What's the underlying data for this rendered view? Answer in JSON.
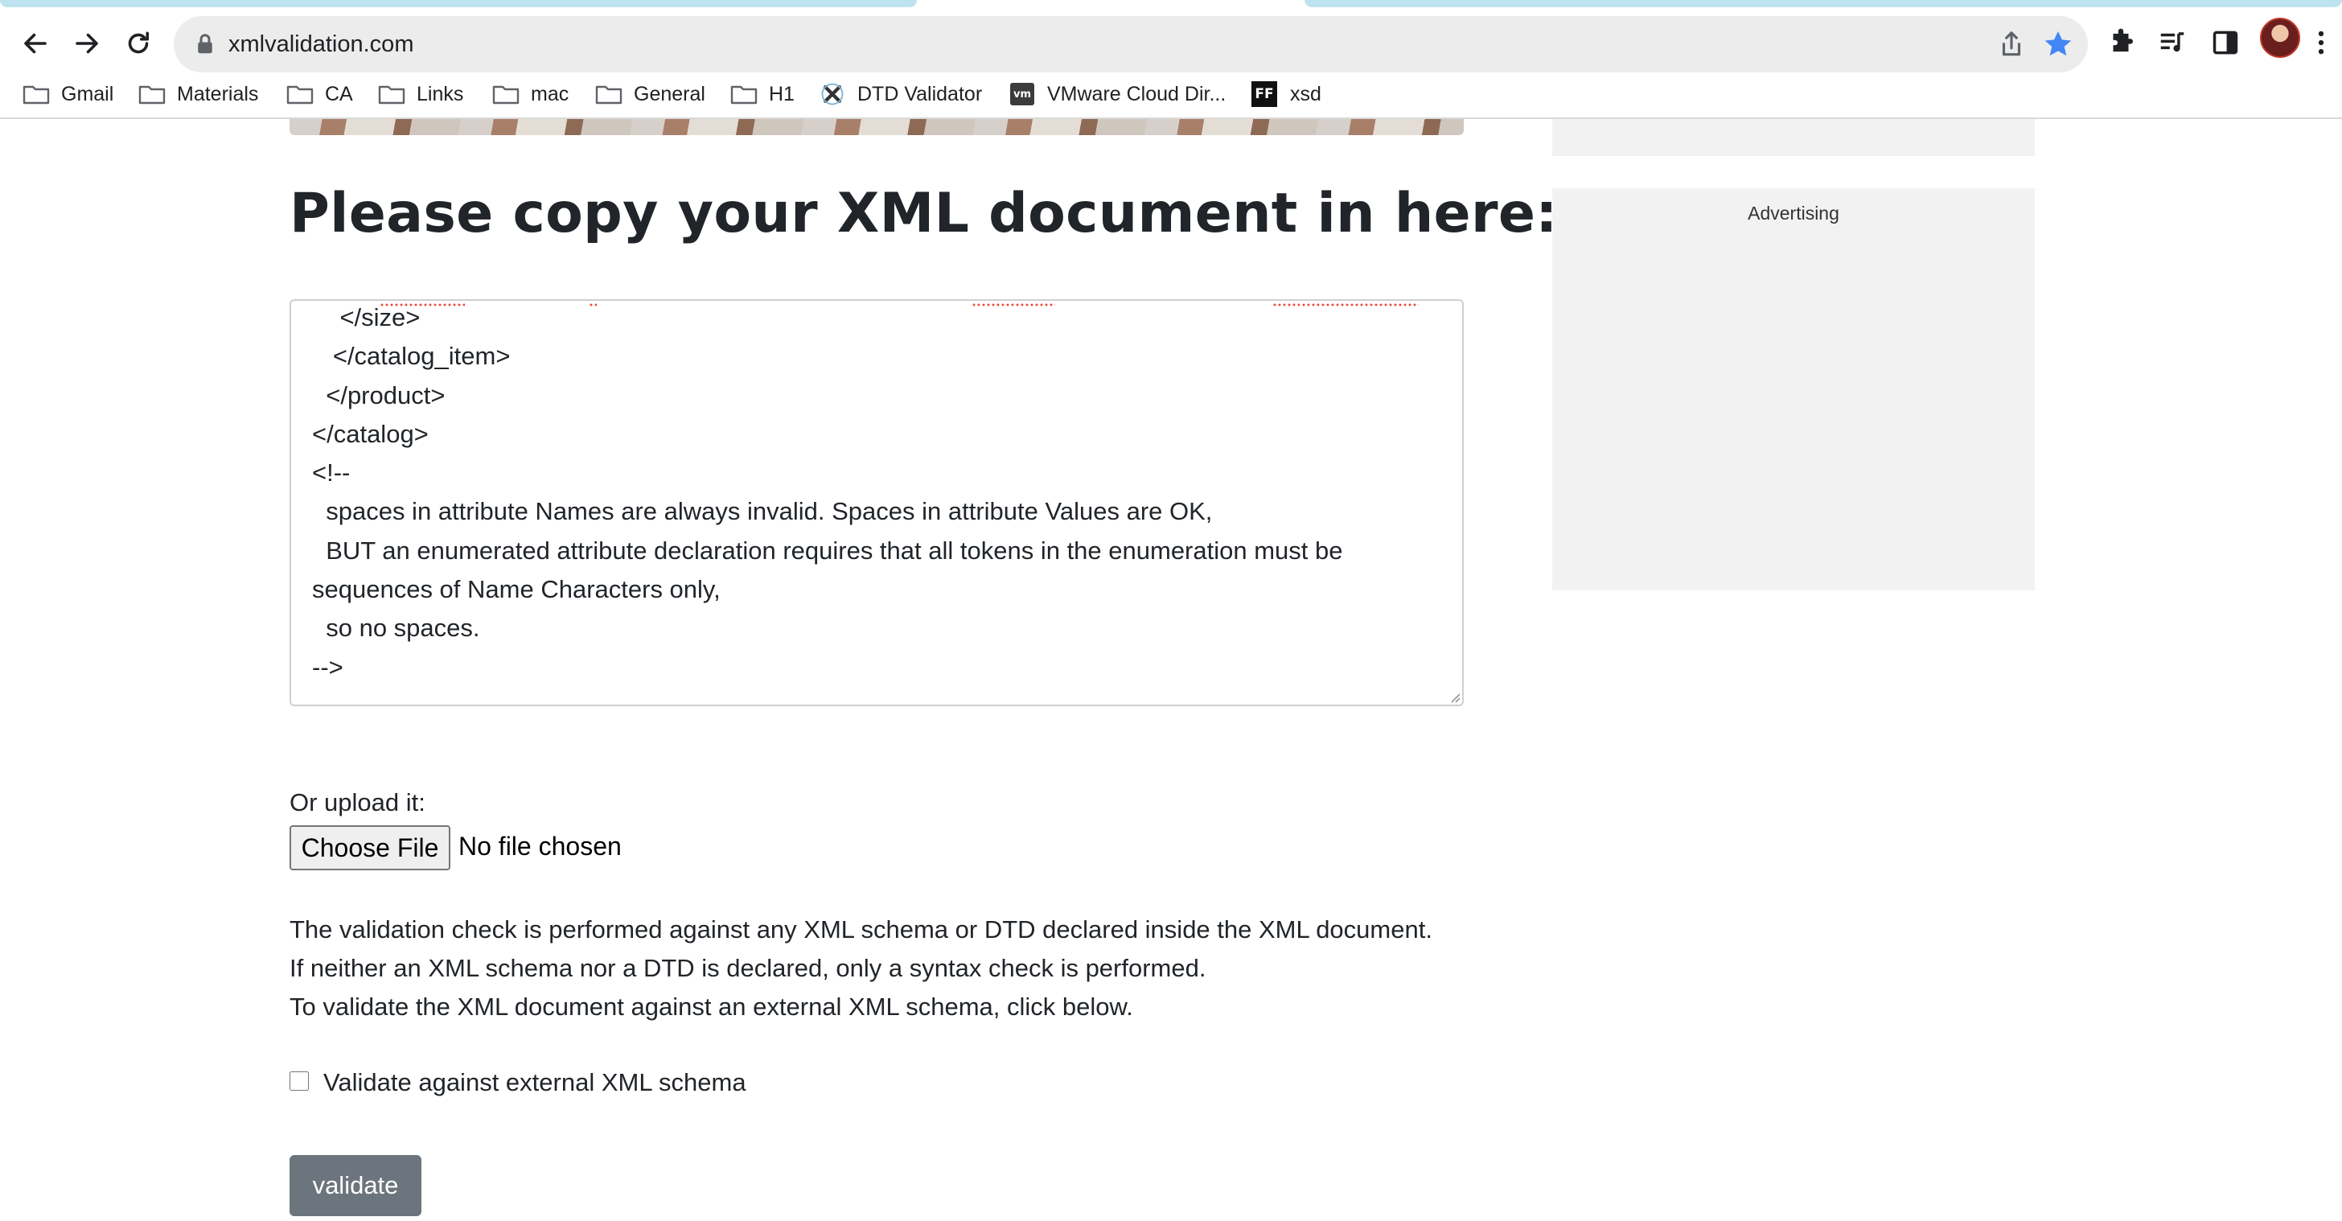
{
  "browser": {
    "url": "xmlvalidation.com",
    "bookmarks": [
      {
        "label": "Gmail",
        "icon": "folder-icon"
      },
      {
        "label": "Materials",
        "icon": "folder-icon"
      },
      {
        "label": "CA",
        "icon": "folder-icon"
      },
      {
        "label": "Links",
        "icon": "folder-icon"
      },
      {
        "label": "mac",
        "icon": "folder-icon"
      },
      {
        "label": "General",
        "icon": "folder-icon"
      },
      {
        "label": "H1",
        "icon": "folder-icon"
      },
      {
        "label": "DTD Validator",
        "icon": "dtd-validator-favicon"
      },
      {
        "label": "VMware Cloud Dir...",
        "icon": "vmware-favicon",
        "favicon_text": "vm"
      },
      {
        "label": "xsd",
        "icon": "ff-favicon",
        "favicon_text": "FF"
      }
    ]
  },
  "page": {
    "heading": "Please copy your XML document in here:",
    "advertising_label": "Advertising",
    "xml_lines": [
      "    </size>",
      "   </catalog_item>",
      "  </product>",
      "</catalog>",
      "<!--",
      "  spaces in attribute Names are always invalid. Spaces in attribute Values are OK,",
      "  BUT an enumerated attribute declaration requires that all tokens in the enumeration must be",
      "sequences of Name Characters only,",
      "  so no spaces.",
      "-->"
    ],
    "upload_label": "Or upload it:",
    "choose_file_label": "Choose File",
    "no_file_text": "No file chosen",
    "info_lines": [
      "The validation check is performed against any XML schema or DTD declared inside the XML document.",
      "If neither an XML schema nor a DTD is declared, only a syntax check is performed.",
      "To validate the XML document against an external XML schema, click below."
    ],
    "external_schema_label": "Validate against external XML schema",
    "external_schema_checked": false,
    "validate_label": "validate"
  },
  "colors": {
    "star_active": "#4285f4",
    "validate_button": "#6c757d",
    "ad_background": "#f2f2f2",
    "spellcheck": "#e74c3c"
  }
}
